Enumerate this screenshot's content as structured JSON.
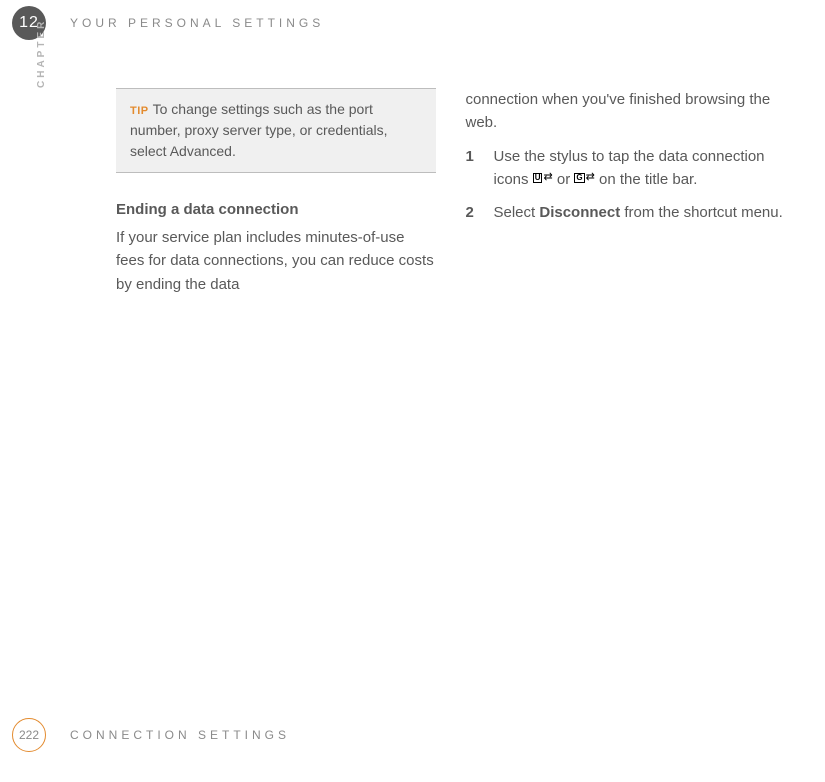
{
  "header": {
    "chapter_number": "12",
    "chapter_label": "CHAPTER",
    "title": "YOUR PERSONAL SETTINGS"
  },
  "left_column": {
    "tip": {
      "label": "TIP",
      "text": "To change settings such as the port number, proxy server type, or credentials, select Advanced."
    },
    "section_heading": "Ending a data connection",
    "section_body": "If your service plan includes minutes-of-use fees for data connections, you can reduce costs by ending the data"
  },
  "right_column": {
    "continuation": "connection when you've finished browsing the web.",
    "steps": [
      {
        "pre": "Use the stylus to tap the data connection icons ",
        "icon1_letter": "U",
        "or": " or ",
        "icon2_letter": "G",
        "post": " on the title bar."
      },
      {
        "pre": "Select ",
        "bold": "Disconnect",
        "post": " from the shortcut menu."
      }
    ]
  },
  "footer": {
    "page_number": "222",
    "section_title": "CONNECTION SETTINGS"
  }
}
